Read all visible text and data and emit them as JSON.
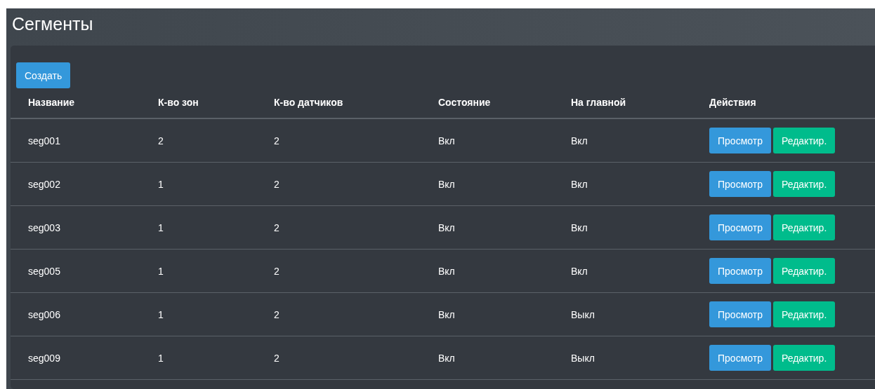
{
  "page": {
    "title": "Сегменты"
  },
  "create_button": "Создать",
  "table": {
    "columns": [
      "Название",
      "К-во зон",
      "К-во датчиков",
      "Состояние",
      "На главной",
      "Действия"
    ],
    "rows": [
      {
        "name": "seg001",
        "zones": "2",
        "sensors": "2",
        "state": "Вкл",
        "on_main": "Вкл",
        "actions": [
          {
            "kind": "view",
            "label": "Просмотр"
          },
          {
            "kind": "edit",
            "label": "Редактир."
          }
        ]
      },
      {
        "name": "seg002",
        "zones": "1",
        "sensors": "2",
        "state": "Вкл",
        "on_main": "Вкл",
        "actions": [
          {
            "kind": "view",
            "label": "Просмотр"
          },
          {
            "kind": "edit",
            "label": "Редактир."
          }
        ]
      },
      {
        "name": "seg003",
        "zones": "1",
        "sensors": "2",
        "state": "Вкл",
        "on_main": "Вкл",
        "actions": [
          {
            "kind": "view",
            "label": "Просмотр"
          },
          {
            "kind": "edit",
            "label": "Редактир."
          }
        ]
      },
      {
        "name": "seg005",
        "zones": "1",
        "sensors": "2",
        "state": "Вкл",
        "on_main": "Вкл",
        "actions": [
          {
            "kind": "view",
            "label": "Просмотр"
          },
          {
            "kind": "edit",
            "label": "Редактир."
          }
        ]
      },
      {
        "name": "seg006",
        "zones": "1",
        "sensors": "2",
        "state": "Вкл",
        "on_main": "Выкл",
        "actions": [
          {
            "kind": "view",
            "label": "Просмотр"
          },
          {
            "kind": "edit",
            "label": "Редактир."
          }
        ]
      },
      {
        "name": "seg009",
        "zones": "1",
        "sensors": "2",
        "state": "Вкл",
        "on_main": "Выкл",
        "actions": [
          {
            "kind": "view",
            "label": "Просмотр"
          },
          {
            "kind": "edit",
            "label": "Редактир."
          }
        ]
      }
    ]
  }
}
